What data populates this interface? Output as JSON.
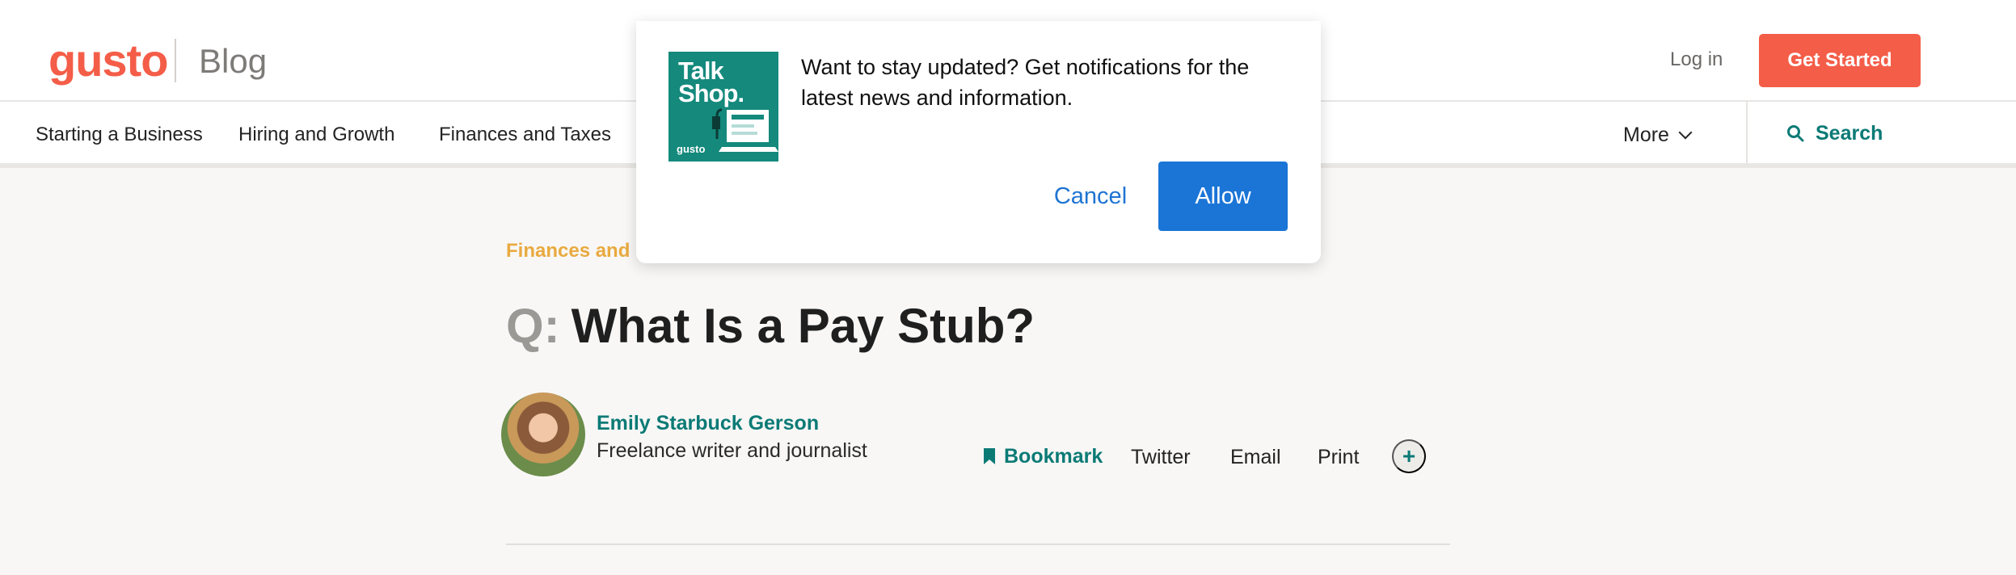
{
  "header": {
    "logo": "gusto",
    "section": "Blog",
    "login_label": "Log in",
    "cta_label": "Get Started"
  },
  "nav": {
    "items": [
      "Starting a Business",
      "Hiring and Growth",
      "Finances and Taxes"
    ],
    "more_label": "More",
    "search_label": "Search"
  },
  "article": {
    "category": "Finances and",
    "title_prefix": "Q:",
    "title": "What Is a Pay Stub?",
    "author_name": "Emily Starbuck Gerson",
    "author_role": "Freelance writer and journalist",
    "share": {
      "bookmark": "Bookmark",
      "twitter": "Twitter",
      "email": "Email",
      "print": "Print",
      "more": "+"
    }
  },
  "popup": {
    "logo_line1": "Talk",
    "logo_line2": "Shop.",
    "logo_brand": "gusto",
    "message": "Want to stay updated? Get notifications for the latest news and information.",
    "cancel_label": "Cancel",
    "allow_label": "Allow"
  },
  "colors": {
    "brand": "#f45d48",
    "accent_teal": "#0b7a75",
    "category": "#e9aa3f",
    "allow_blue": "#1a75d6"
  }
}
